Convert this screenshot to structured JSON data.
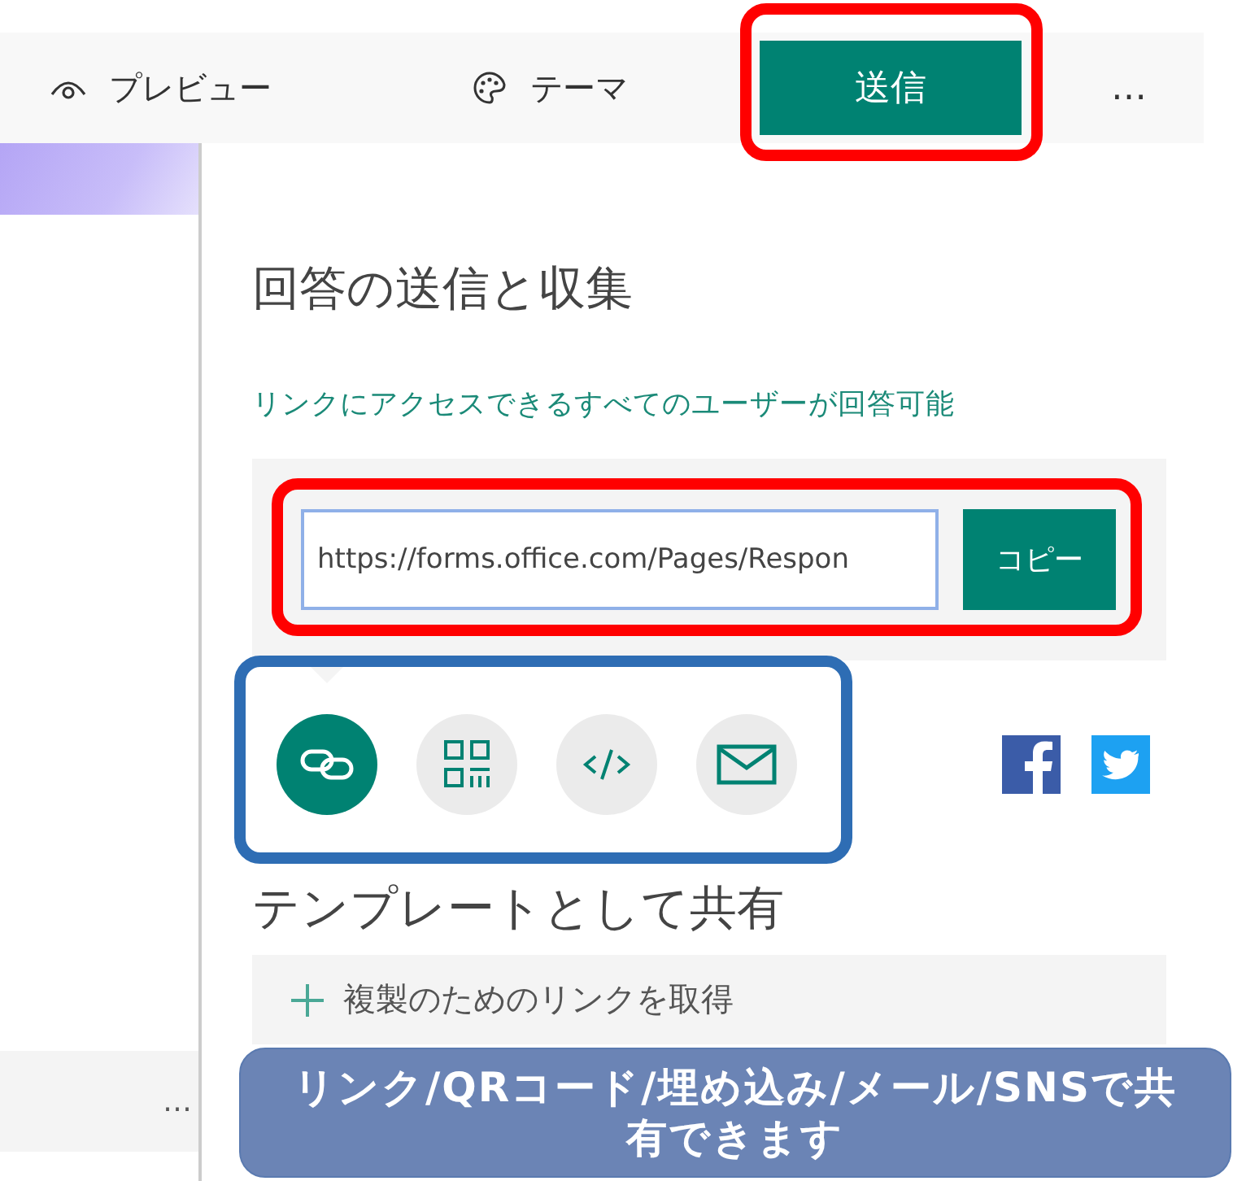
{
  "toolbar": {
    "items": [
      {
        "kind": "preview",
        "label": "プレビュー"
      },
      {
        "kind": "theme",
        "label": "テーマ"
      }
    ],
    "send_button": "送信",
    "more": "…"
  },
  "panel": {
    "title": "回答の送信と収集",
    "access_note": "リンクにアクセスできるすべてのユーザーが回答可能",
    "link_field": {
      "value": "https://forms.office.com/Pages/Respon"
    },
    "copy_button": "コピー",
    "share_options": [
      {
        "kind": "link",
        "selected": true
      },
      {
        "kind": "qr",
        "selected": false
      },
      {
        "kind": "embed",
        "selected": false
      },
      {
        "kind": "mail",
        "selected": false
      }
    ],
    "social": [
      {
        "kind": "facebook"
      },
      {
        "kind": "twitter"
      }
    ],
    "template_title": "テンプレートとして共有",
    "template_action": "複製のためのリンクを取得"
  },
  "left_pane": {
    "more": "…"
  },
  "callout": {
    "text": "リンク/QRコード/埋め込み/メール/SNSで共有できます"
  }
}
